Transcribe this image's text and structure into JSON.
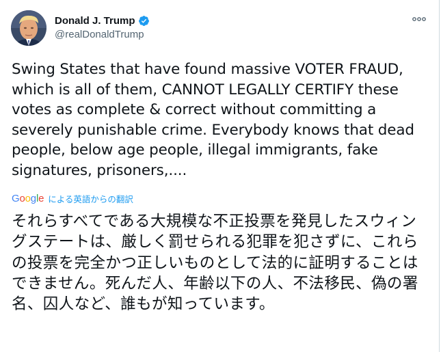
{
  "tweet": {
    "author": {
      "display_name": "Donald J. Trump",
      "handle": "@realDonaldTrump",
      "verified_icon": "verified-badge-icon",
      "avatar_icon": "avatar"
    },
    "more_icon": "more-options-icon",
    "text": "Swing States that have found massive VOTER FRAUD, which is all of them, CANNOT LEGALLY CERTIFY these votes as complete & correct without committing a severely punishable crime. Everybody knows that dead people, below age people, illegal immigrants, fake signatures, prisoners,....",
    "translation": {
      "provider": "Google",
      "label": "による英語からの翻訳",
      "text": "それらすべてである大規模な不正投票を発見したスウィングステートは、厳しく罰せられる犯罪を犯さずに、これらの投票を完全かつ正しいものとして法的に証明することはできません。死んだ人、年齢以下の人、不法移民、偽の署名、囚人など、誰もが知っています。"
    }
  },
  "colors": {
    "text_primary": "#0f1419",
    "text_secondary": "#536471",
    "link": "#1d9bf0",
    "verified": "#1d9bf0",
    "border": "#cfd9de"
  }
}
